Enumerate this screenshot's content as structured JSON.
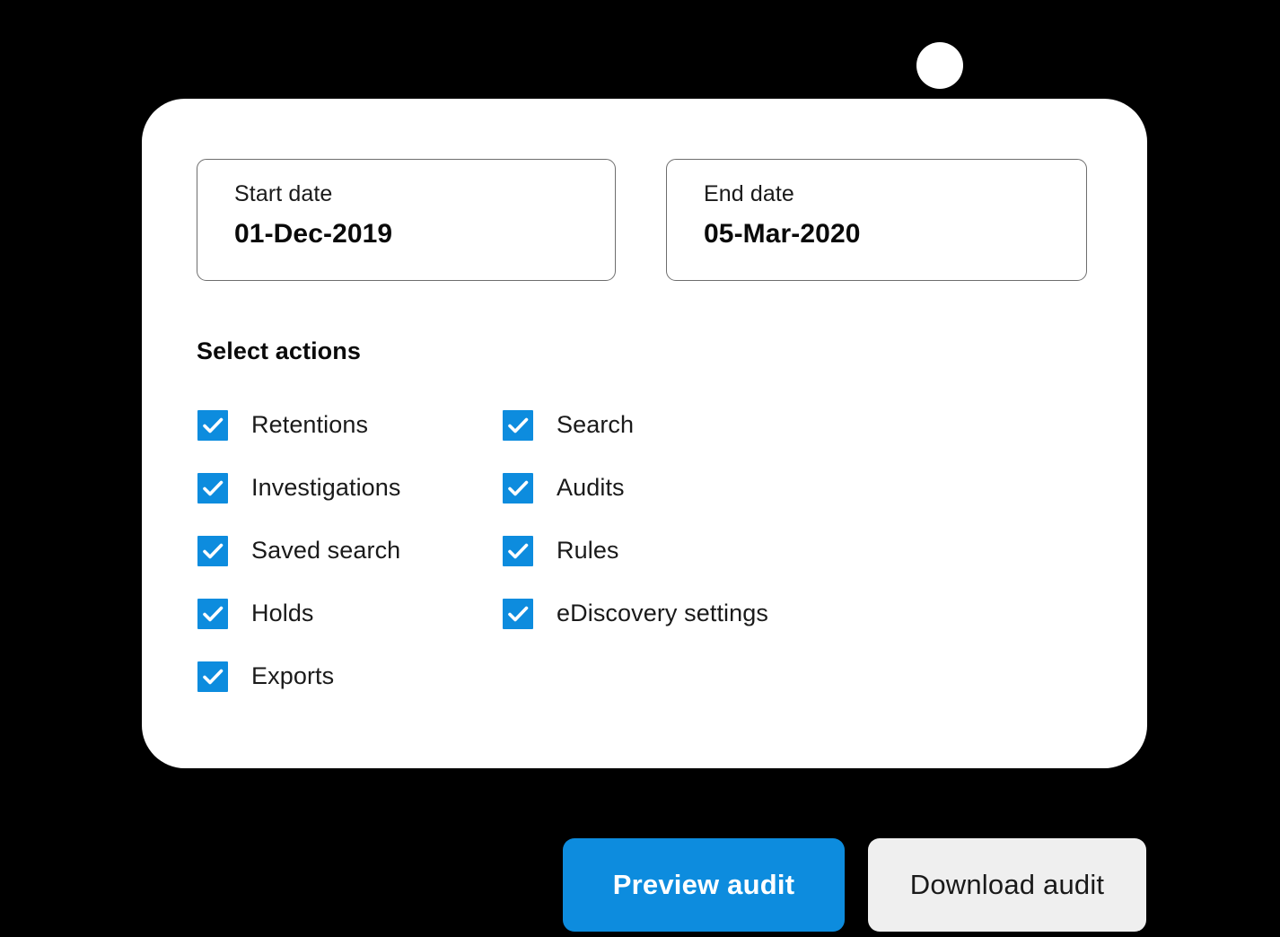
{
  "theme": {
    "background": "#000000",
    "card_background": "#ffffff",
    "accent_blue": "#0d8cde",
    "muted_grey": "#efefef",
    "border_grey": "#6e6e6e",
    "text_dark": "#1a1a1a"
  },
  "date_range": {
    "start": {
      "label": "Start date",
      "value": "01-Dec-2019"
    },
    "end": {
      "label": "End date",
      "value": "05-Mar-2020"
    }
  },
  "actions_section": {
    "heading": "Select actions",
    "left_column": [
      {
        "label": "Retentions",
        "checked": true
      },
      {
        "label": "Investigations",
        "checked": true
      },
      {
        "label": "Saved search",
        "checked": true
      },
      {
        "label": "Holds",
        "checked": true
      },
      {
        "label": "Exports",
        "checked": true
      }
    ],
    "right_column": [
      {
        "label": "Search",
        "checked": true
      },
      {
        "label": "Audits",
        "checked": true
      },
      {
        "label": "Rules",
        "checked": true
      },
      {
        "label": "eDiscovery settings",
        "checked": true
      }
    ]
  },
  "footer": {
    "primary_button": "Preview audit",
    "secondary_button": "Download audit"
  },
  "icons": {
    "checkmark": "checkmark-icon",
    "notch": "notch-circle-icon"
  }
}
